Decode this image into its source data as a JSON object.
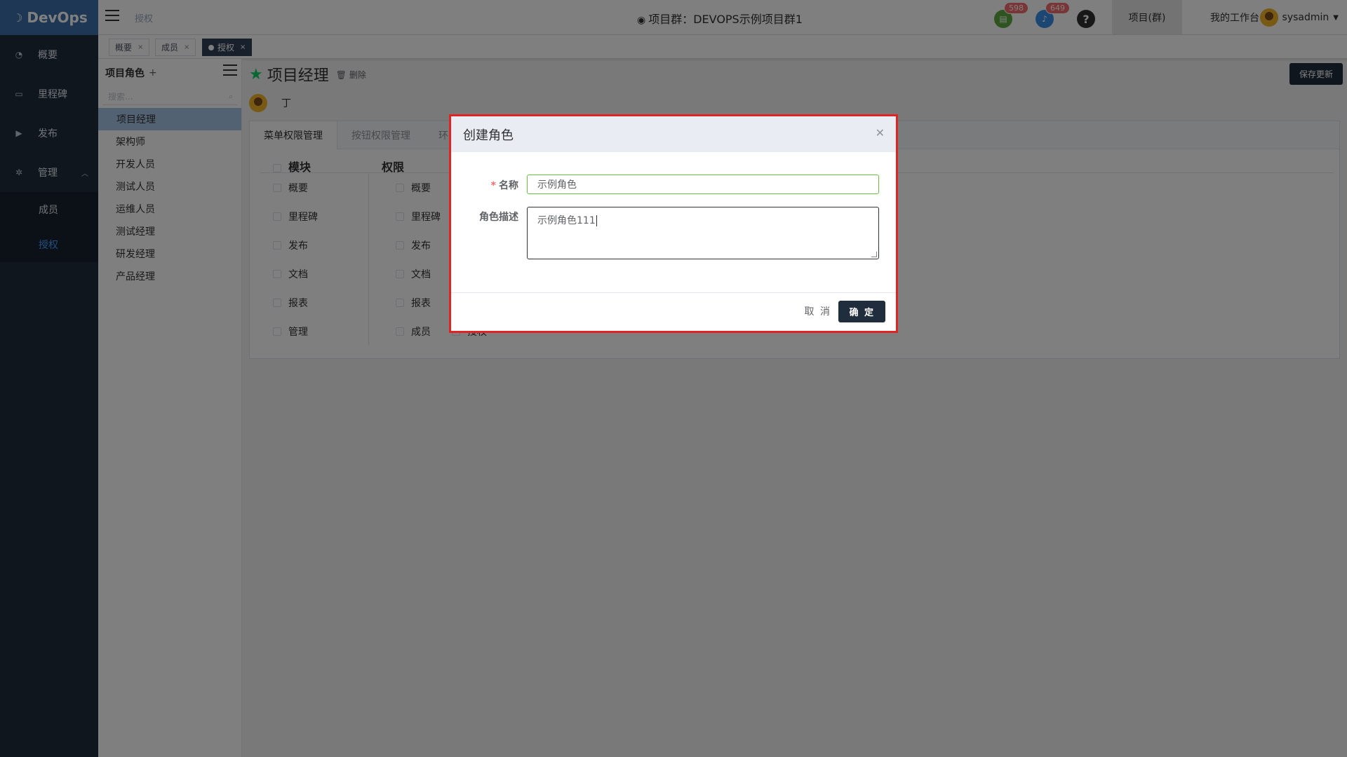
{
  "app": {
    "logo_text": "DevOps"
  },
  "sidebar": {
    "items": [
      {
        "label": "概要",
        "icon": "dashboard-icon"
      },
      {
        "label": "里程碑",
        "icon": "calendar-icon"
      },
      {
        "label": "发布",
        "icon": "forward-icon"
      },
      {
        "label": "管理",
        "icon": "gear-icon"
      }
    ],
    "sub_items": [
      {
        "label": "成员"
      },
      {
        "label": "授权",
        "active": true
      }
    ]
  },
  "header": {
    "breadcrumb": "授权",
    "title": "项目群：DEVOPS示例项目群1",
    "badge_docs": "598",
    "badge_bell": "649",
    "link_project": "项目(群)",
    "link_workspace": "我的工作台",
    "username": "sysadmin"
  },
  "tags": [
    {
      "label": "概要"
    },
    {
      "label": "成员"
    },
    {
      "label": "授权",
      "active": true
    }
  ],
  "roles_panel": {
    "title": "项目角色",
    "add": "+",
    "search_placeholder": "搜索...",
    "roles": [
      "项目经理",
      "架构师",
      "开发人员",
      "测试人员",
      "运维人员",
      "测试经理",
      "研发经理",
      "产品经理"
    ]
  },
  "main": {
    "title": "项目经理",
    "delete_label": "删除",
    "save_label": "保存更新",
    "owner_name": "丁",
    "tabs": [
      "菜单权限管理",
      "按钮权限管理",
      "环"
    ],
    "col_module": "模块",
    "col_perm": "权限",
    "modules": [
      "概要",
      "里程碑",
      "发布",
      "文档",
      "报表",
      "管理"
    ],
    "perms": [
      "概要",
      "里程碑",
      "发布",
      "文档",
      "报表",
      "成员"
    ],
    "extra_perm": "授权"
  },
  "dialog": {
    "title": "创建角色",
    "name_label": "名称",
    "name_value": "示例角色",
    "desc_label": "角色描述",
    "desc_value": "示例角色111",
    "cancel_label": "取 消",
    "ok_label": "确 定"
  },
  "colors": {
    "sidebar_bg": "#1f2d3d",
    "logo_bg": "#3a6ea8",
    "active_link": "#409eff",
    "badge": "#f56c6c",
    "dialog_border": "#e02424",
    "valid_border": "#67c23a",
    "primary_btn": "#1f2d3d"
  }
}
